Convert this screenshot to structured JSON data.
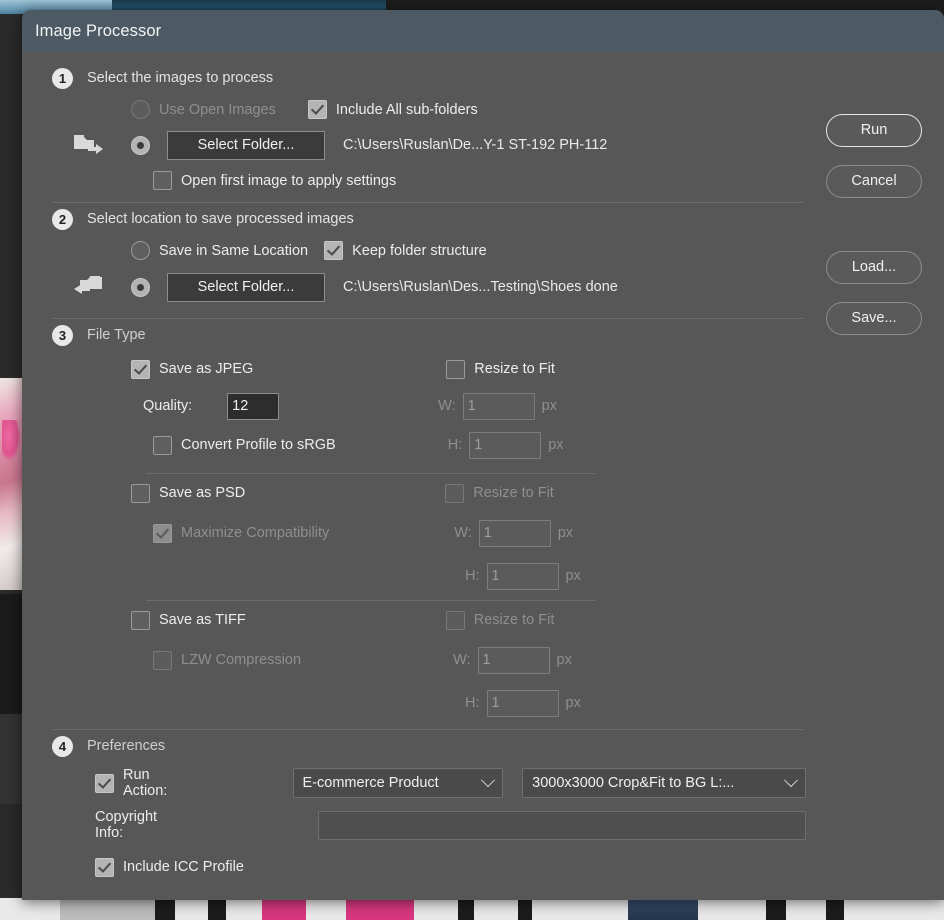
{
  "window": {
    "title": "Image Processor"
  },
  "sidebar": {
    "run_label": "Run",
    "cancel_label": "Cancel",
    "load_label": "Load...",
    "save_label": "Save..."
  },
  "section1": {
    "number": "1",
    "title": "Select the images to process",
    "use_open_images_label": "Use Open Images",
    "use_open_images_selected": false,
    "use_open_images_enabled": false,
    "include_subfolders_label": "Include All sub-folders",
    "include_subfolders_checked": true,
    "select_folder_label": "Select Folder...",
    "folder_radio_selected": true,
    "folder_path": "C:\\Users\\Ruslan\\De...Y-1 ST-192 PH-112",
    "open_first_image_label": "Open first image to apply settings",
    "open_first_image_checked": false
  },
  "section2": {
    "number": "2",
    "title": "Select location to save processed images",
    "save_same_location_label": "Save in Same Location",
    "save_same_location_selected": false,
    "keep_folder_structure_label": "Keep folder structure",
    "keep_folder_structure_checked": true,
    "select_folder_label": "Select Folder...",
    "folder_radio_selected": true,
    "folder_path": "C:\\Users\\Ruslan\\Des...Testing\\Shoes done"
  },
  "section3": {
    "number": "3",
    "title": "File Type",
    "jpeg": {
      "label": "Save as JPEG",
      "checked": true,
      "quality_label": "Quality:",
      "quality_value": "12",
      "convert_srgb_label": "Convert Profile to sRGB",
      "convert_srgb_checked": false,
      "resize_label": "Resize to Fit",
      "resize_checked": false,
      "width_prefix": "W:",
      "width_value": "1",
      "height_prefix": "H:",
      "height_value": "1",
      "unit": "px"
    },
    "psd": {
      "label": "Save as PSD",
      "checked": false,
      "maximize_compat_label": "Maximize Compatibility",
      "maximize_compat_checked": true,
      "resize_label": "Resize to Fit",
      "resize_checked": false,
      "width_prefix": "W:",
      "width_value": "1",
      "height_prefix": "H:",
      "height_value": "1",
      "unit": "px"
    },
    "tiff": {
      "label": "Save as TIFF",
      "checked": false,
      "lzw_label": "LZW Compression",
      "lzw_checked": false,
      "resize_label": "Resize to Fit",
      "resize_checked": false,
      "width_prefix": "W:",
      "width_value": "1",
      "height_prefix": "H:",
      "height_value": "1",
      "unit": "px"
    }
  },
  "section4": {
    "number": "4",
    "title": "Preferences",
    "run_action_label": "Run Action:",
    "run_action_checked": true,
    "action_set_value": "E-commerce Product",
    "action_value": "3000x3000 Crop&Fit to BG L:...",
    "copyright_label": "Copyright Info:",
    "copyright_value": "",
    "include_icc_label": "Include ICC Profile",
    "include_icc_checked": true
  },
  "colors": {
    "dialog_bg": "#575757",
    "titlebar_bg": "#4d5a63",
    "button_bg": "#3b3b3b",
    "input_bg": "#2d2d2d",
    "text": "#ededed",
    "text_disabled": "#8f8f8f"
  }
}
